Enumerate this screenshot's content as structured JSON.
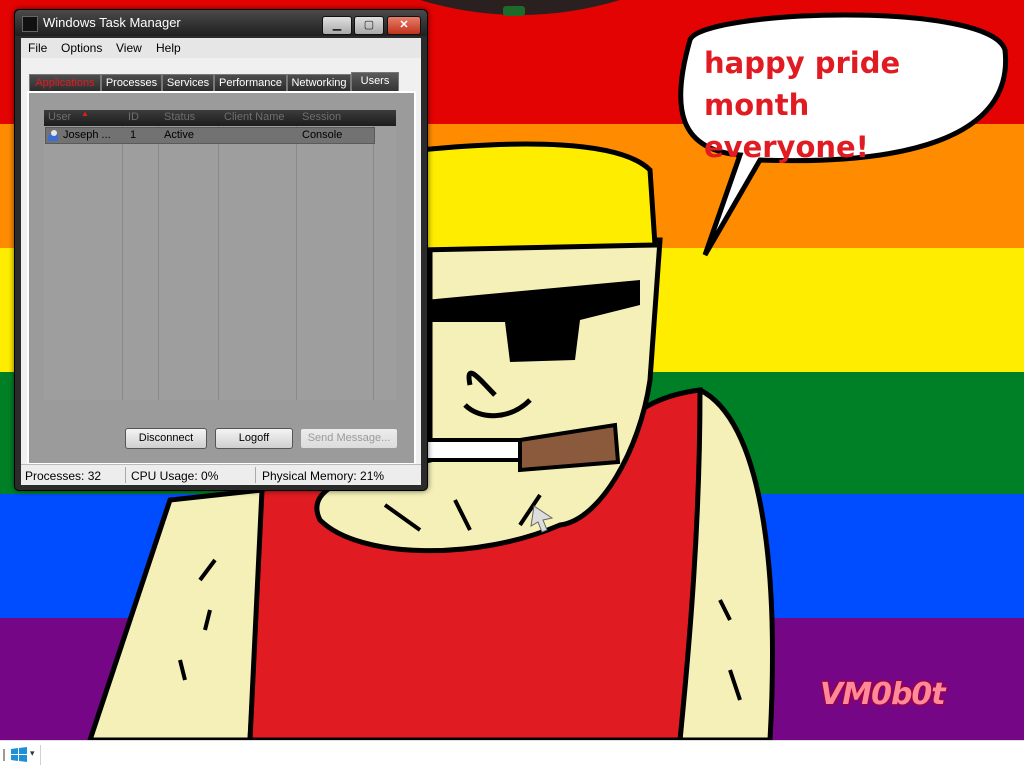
{
  "wallpaper": {
    "speech_bubble_text": [
      "happy pride month",
      "everyone!"
    ],
    "watermark": "VM0b0t",
    "stripe_colors": [
      "#e40303",
      "#ff8c00",
      "#ffed00",
      "#008026",
      "#004dff",
      "#750787"
    ]
  },
  "window": {
    "title": "Windows Task Manager",
    "controls": {
      "minimize": "▁",
      "maximize": "▢",
      "close": "✕"
    },
    "menu": [
      "File",
      "Options",
      "View",
      "Help"
    ],
    "tabs": [
      "Applications",
      "Processes",
      "Services",
      "Performance",
      "Networking",
      "Users"
    ],
    "active_tab": "Users",
    "users_list": {
      "columns": [
        "User",
        "ID",
        "Status",
        "Client Name",
        "Session"
      ],
      "rows": [
        {
          "user": "Joseph ...",
          "id": "1",
          "status": "Active",
          "client_name": "",
          "session": "Console"
        }
      ]
    },
    "buttons": {
      "disconnect": "Disconnect",
      "logoff": "Logoff",
      "send_message": "Send Message..."
    },
    "status": {
      "processes": "Processes: 32",
      "cpu": "CPU Usage: 0%",
      "memory": "Physical Memory: 21%"
    }
  },
  "taskbar": {
    "start_icon": "windows-logo-icon",
    "start_menu_indicator": "▾"
  }
}
